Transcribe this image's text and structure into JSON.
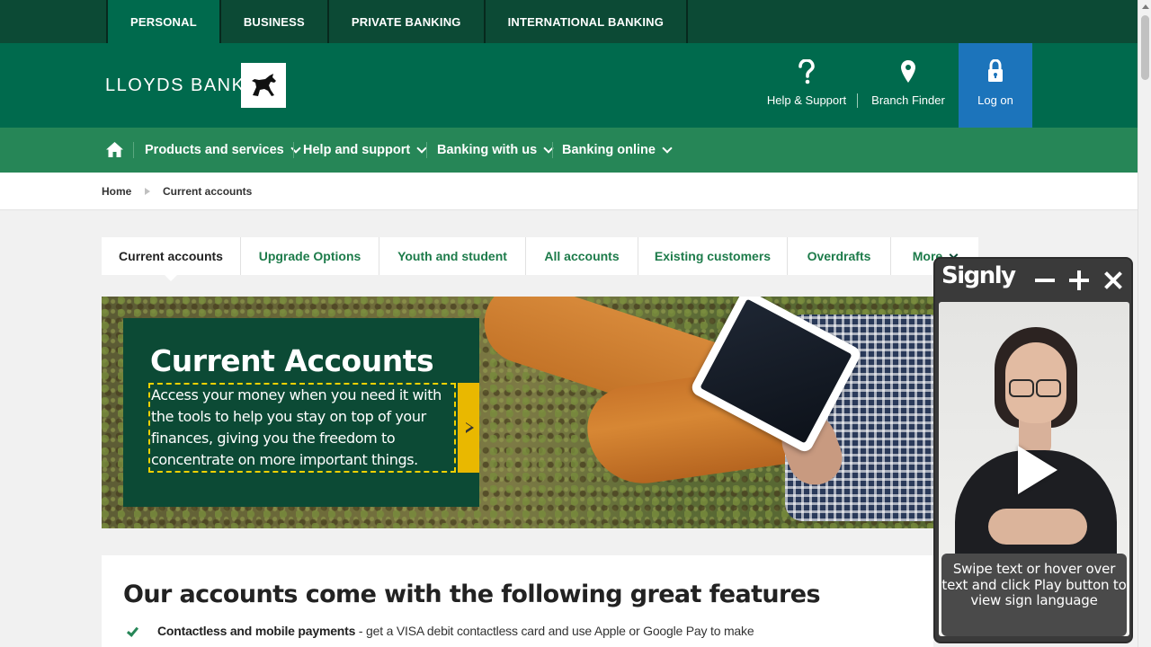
{
  "segments": {
    "items": [
      {
        "label": "PERSONAL",
        "active": true
      },
      {
        "label": "BUSINESS",
        "active": false
      },
      {
        "label": "PRIVATE BANKING",
        "active": false
      },
      {
        "label": "INTERNATIONAL BANKING",
        "active": false
      }
    ]
  },
  "header": {
    "brand": "LLOYDS BANK",
    "help_label": "Help & Support",
    "branch_label": "Branch Finder",
    "logon_label": "Log on"
  },
  "nav": {
    "items": [
      {
        "label": "Products and services"
      },
      {
        "label": "Help and support"
      },
      {
        "label": "Banking with us"
      },
      {
        "label": "Banking online"
      }
    ]
  },
  "breadcrumb": {
    "home": "Home",
    "current": "Current accounts"
  },
  "subtabs": {
    "items": [
      {
        "label": "Current accounts",
        "active": true
      },
      {
        "label": "Upgrade Options"
      },
      {
        "label": "Youth and student"
      },
      {
        "label": "All accounts"
      },
      {
        "label": "Existing customers"
      },
      {
        "label": "Overdrafts"
      },
      {
        "label": "More"
      }
    ]
  },
  "hero": {
    "title": "Current Accounts",
    "description": "Access your money when you need it with the tools to help you stay on top of your finances, giving you the freedom to concentrate on more important things."
  },
  "features": {
    "title": "Our accounts come with the following great features",
    "items": [
      {
        "bold": "Contactless and mobile payments",
        "text": " - get a VISA debit contactless card and use Apple or Google Pay to make"
      }
    ]
  },
  "signly": {
    "logo": "Signly",
    "caption": "Swipe text or hover over text and click Play button to view sign language"
  },
  "colors": {
    "brand_dark": "#0c4a35",
    "brand": "#006a4d",
    "nav": "#268657",
    "logon": "#1c74bb",
    "highlight": "#f2d100"
  }
}
